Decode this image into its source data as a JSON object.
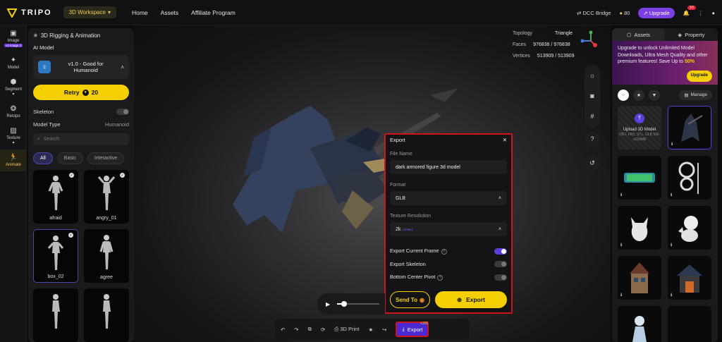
{
  "topbar": {
    "logo": "TRIPO",
    "workspace": "3D Workspace",
    "nav": [
      "Home",
      "Assets",
      "Affiliate Program"
    ],
    "dcc": "DCC Bridge",
    "credits": "80",
    "upgrade": "Upgrade",
    "notifications": "10"
  },
  "rail": {
    "items": [
      {
        "label": "Image",
        "tag": "v3 Image 2"
      },
      {
        "label": "Model"
      },
      {
        "label": "Segment"
      },
      {
        "label": "Retopo"
      },
      {
        "label": "Texture"
      },
      {
        "label": "Animate"
      }
    ]
  },
  "left": {
    "title": "3D Rigging & Animation",
    "ai_model_label": "AI Model",
    "model_line1": "v1.0 - Good for",
    "model_line2": "Humanoid",
    "retry_label": "Retry",
    "retry_cost": "20",
    "skeleton_label": "Skeleton",
    "model_type_label": "Model Type",
    "model_type_value": "Humanoid",
    "search_placeholder": "Search",
    "chips": [
      "All",
      "Basic",
      "Interactive"
    ],
    "animations": [
      {
        "name": "afraid",
        "checked": true
      },
      {
        "name": "angry_01",
        "checked": true
      },
      {
        "name": "box_02",
        "checked": true
      },
      {
        "name": "agree",
        "checked": false
      },
      {
        "name": "",
        "checked": false
      },
      {
        "name": "",
        "checked": false
      }
    ]
  },
  "stats": {
    "topology_label": "Topology",
    "topology_value": "Triangle",
    "faces_label": "Faces",
    "faces_value": "976838 / 976838",
    "vertices_label": "Vertices",
    "vertices_value": "513909 / 513909"
  },
  "export_dialog": {
    "title": "Export",
    "file_name_label": "File Name",
    "file_name_value": "dark armored figure 3d model",
    "format_label": "Format",
    "format_value": "GLB",
    "texture_label": "Texture Resolution",
    "texture_value": "2k",
    "texture_tag": "Limited",
    "opt_frame": "Export Current Frame",
    "opt_skeleton": "Export Skeleton",
    "opt_pivot": "Bottom Center Pivot",
    "send_to": "Send To",
    "export": "Export"
  },
  "bottombar": {
    "print": "3D Print",
    "share_bonus": "+300",
    "export": "Export"
  },
  "right": {
    "tab_assets": "Assets",
    "tab_property": "Property",
    "promo_text": "Upgrade to unlock Unlimited Model Downloads, Ultra Mesh Quality and other premium features! Save Up to",
    "promo_pct": "50%",
    "promo_btn": "Upgrade",
    "manage": "Manage",
    "upload_title": "Upload 3D Model",
    "upload_sub": "OBJ, FBX, STL, GLB 50k, ≤150MB"
  },
  "colors": {
    "accent": "#f5d000",
    "purple": "#5b3fd8",
    "highlight": "#d0141b"
  }
}
